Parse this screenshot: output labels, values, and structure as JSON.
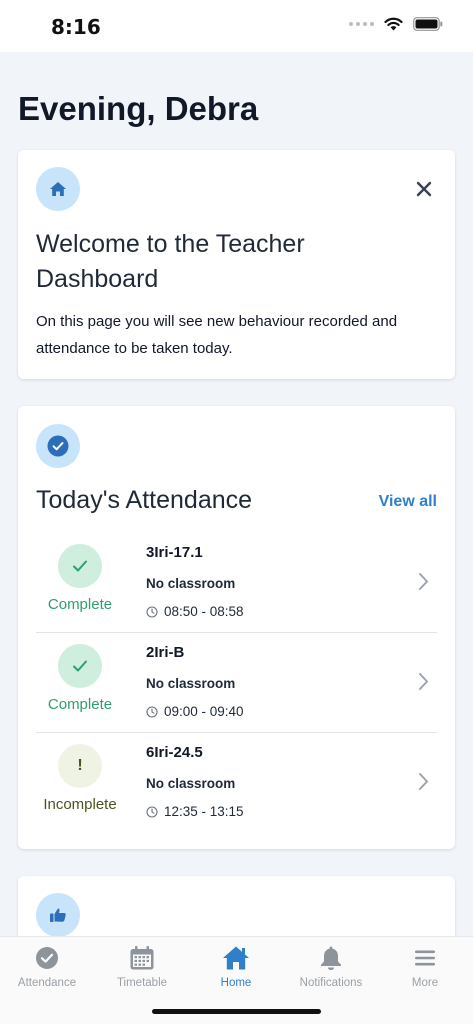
{
  "status_bar": {
    "time": "8:16"
  },
  "greeting": "Evening, Debra",
  "welcome": {
    "title": "Welcome to the Teacher Dashboard",
    "body": "On this page you will see new behaviour recorded and attendance to be taken today."
  },
  "attendance": {
    "title": "Today's Attendance",
    "view_all": "View all",
    "rows": [
      {
        "status": "Complete",
        "class": "3Iri-17.1",
        "room": "No classroom",
        "time": "08:50 - 08:58"
      },
      {
        "status": "Complete",
        "class": "2Iri-B",
        "room": "No classroom",
        "time": "09:00 - 09:40"
      },
      {
        "status": "Incomplete",
        "class": "6Iri-24.5",
        "room": "No classroom",
        "time": "12:35 - 13:15"
      }
    ],
    "incomplete_mark": "!"
  },
  "tabs": [
    {
      "label": "Attendance",
      "icon": "check-circle-icon"
    },
    {
      "label": "Timetable",
      "icon": "calendar-icon"
    },
    {
      "label": "Home",
      "icon": "home-icon",
      "active": true
    },
    {
      "label": "Notifications",
      "icon": "bell-icon"
    },
    {
      "label": "More",
      "icon": "menu-icon"
    }
  ],
  "colors": {
    "accent": "#2f80c9",
    "complete": "#2e9f6b",
    "icon_bg": "#c7e4fb"
  }
}
